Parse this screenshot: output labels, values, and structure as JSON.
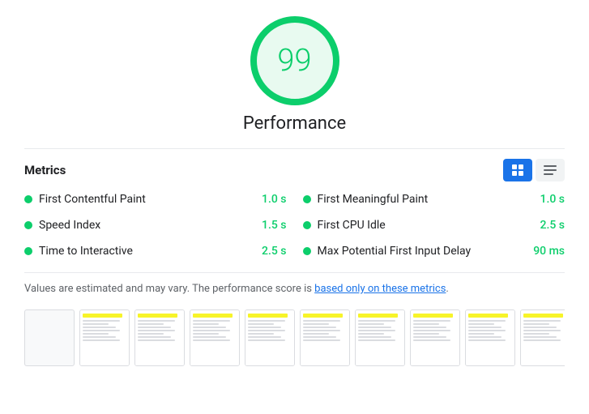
{
  "score": {
    "value": "99",
    "label": "Performance"
  },
  "metrics": {
    "title": "Metrics",
    "toggle": {
      "grid_label": "Grid view",
      "list_label": "List view"
    },
    "items": [
      {
        "name": "First Contentful Paint",
        "value": "1.0 s",
        "color": "green",
        "col": 0
      },
      {
        "name": "First Meaningful Paint",
        "value": "1.0 s",
        "color": "green",
        "col": 1
      },
      {
        "name": "Speed Index",
        "value": "1.5 s",
        "color": "green",
        "col": 0
      },
      {
        "name": "First CPU Idle",
        "value": "2.5 s",
        "color": "green",
        "col": 1
      },
      {
        "name": "Time to Interactive",
        "value": "2.5 s",
        "color": "green",
        "col": 0
      },
      {
        "name": "Max Potential First Input Delay",
        "value": "90 ms",
        "color": "green",
        "col": 1
      }
    ]
  },
  "footer": {
    "text_before": "Values are estimated and may vary. The performance score is ",
    "link_text": "based only on these metrics",
    "text_after": "."
  },
  "filmstrip": {
    "frames": 10
  }
}
